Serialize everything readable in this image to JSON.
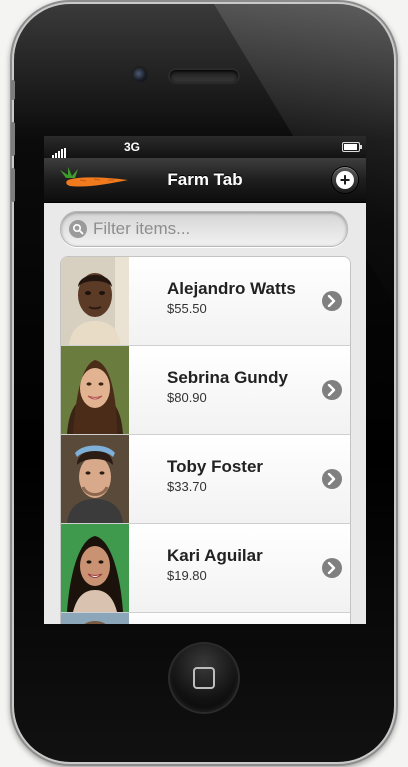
{
  "status_bar": {
    "carrier": "3G"
  },
  "navbar": {
    "title": "Farm Tab",
    "add_icon": "plus-icon",
    "logo_icon": "carrot-icon"
  },
  "search": {
    "placeholder": "Filter items...",
    "value": ""
  },
  "people": [
    {
      "name": "Alejandro Watts",
      "price": "$55.50"
    },
    {
      "name": "Sebrina Gundy",
      "price": "$80.90"
    },
    {
      "name": "Toby Foster",
      "price": "$33.70"
    },
    {
      "name": "Kari Aguilar",
      "price": "$19.80"
    }
  ],
  "colors": {
    "accent_carrot": "#f07a1e",
    "leaf": "#3f9b2e",
    "nav_dark": "#1e1e1e"
  }
}
